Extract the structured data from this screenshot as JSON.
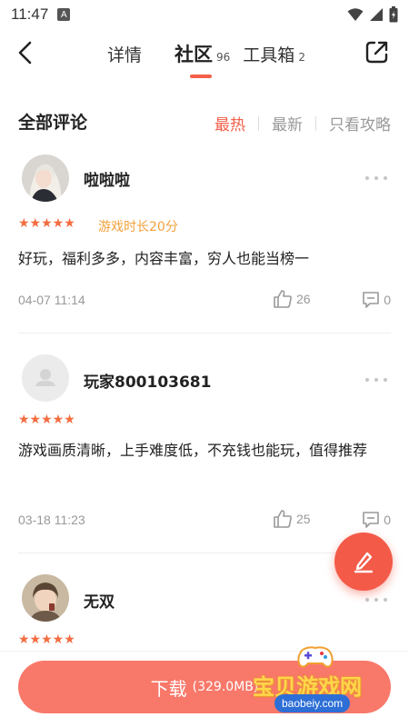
{
  "status_bar": {
    "time": "11:47",
    "notification_letter": "A"
  },
  "nav": {
    "tabs": [
      {
        "label": "详情",
        "count": ""
      },
      {
        "label": "社区",
        "count": "96"
      },
      {
        "label": "工具箱",
        "count": "2"
      }
    ],
    "active_tab": "社区"
  },
  "section": {
    "title": "全部评论",
    "sort_options": [
      "最热",
      "最新",
      "只看攻略"
    ],
    "active_sort": "最热"
  },
  "comments": [
    {
      "username": "啦啦啦",
      "rating": 5,
      "play_time": "游戏时长20分",
      "text": "好玩，福利多多，内容丰富，穷人也能当榜一",
      "date": "04-07 11:14",
      "likes": "26",
      "replies": "0"
    },
    {
      "username": "玩家800103681",
      "rating": 5,
      "play_time": "",
      "text": "游戏画质清晰，上手难度低，不充钱也能玩，值得推荐",
      "date": "03-18 11:23",
      "likes": "25",
      "replies": "0"
    },
    {
      "username": "无双",
      "rating": 5,
      "play_time": "",
      "text": "",
      "date": "",
      "likes": "",
      "replies": ""
    }
  ],
  "stars_glyph": "★★★★★",
  "download": {
    "label": "下载",
    "size": "(329.0MB)"
  },
  "watermark": {
    "text": "宝贝游戏网",
    "url": "baobeiy.com"
  },
  "colors": {
    "accent": "#f3604a",
    "download_button": "#f8786a",
    "star": "#f36c40",
    "play_time": "#f3a13d"
  }
}
